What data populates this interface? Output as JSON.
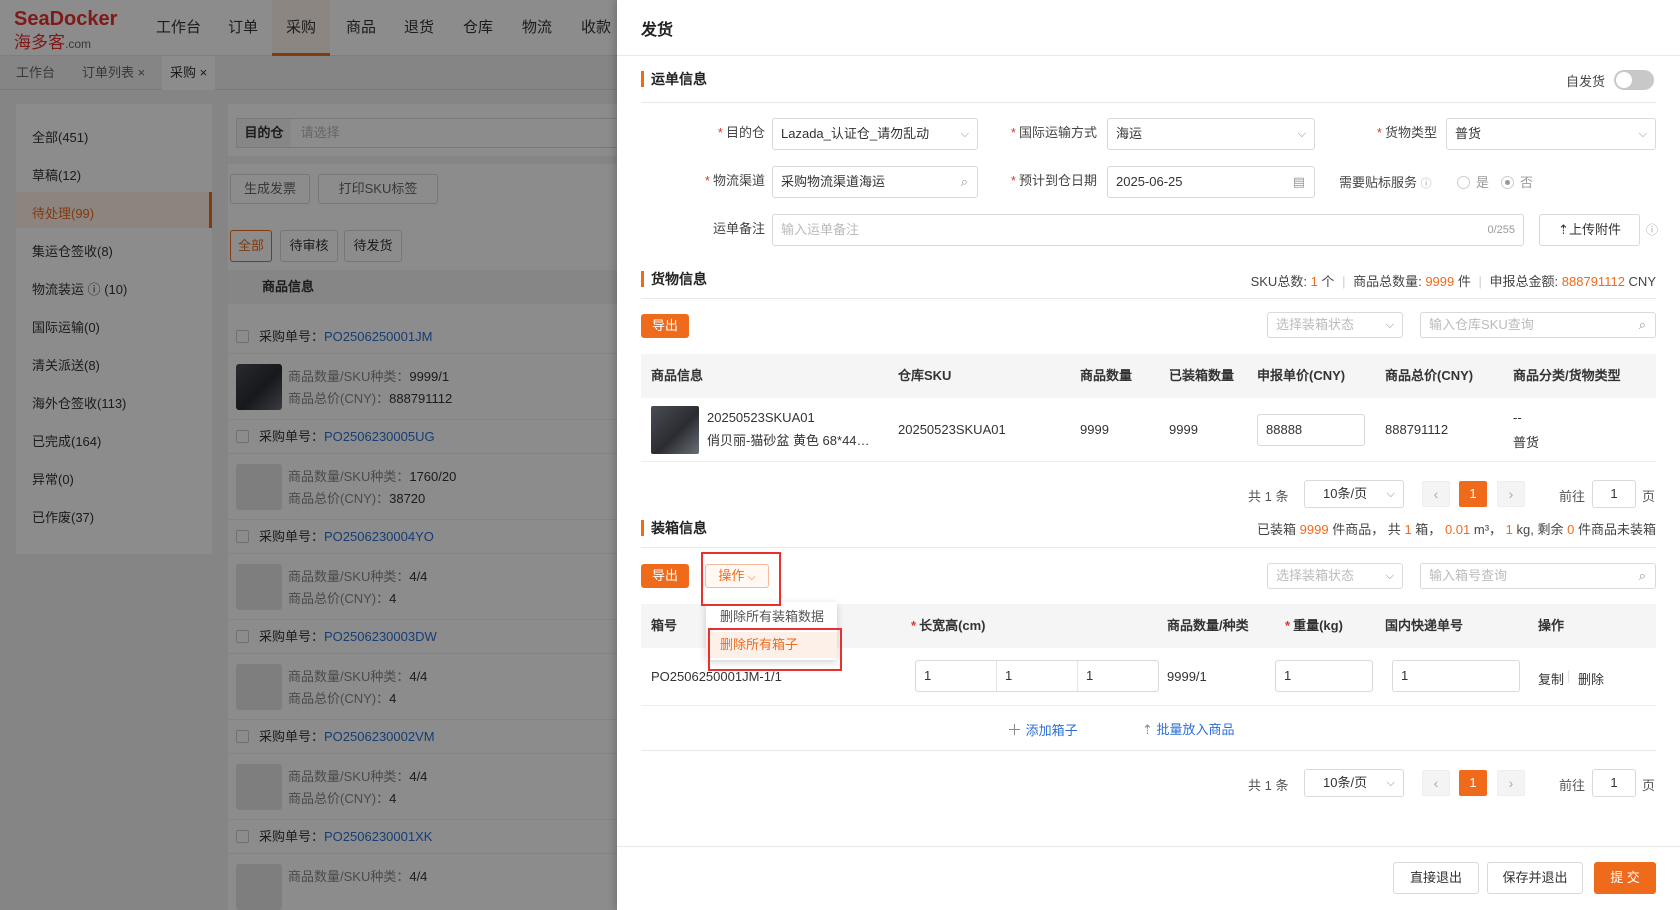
{
  "logo": {
    "brand": "SeaDocker",
    "cn": "海多客",
    "suffix": ".com"
  },
  "topnav": {
    "items": [
      "工作台",
      "订单",
      "采购",
      "商品",
      "退货",
      "仓库",
      "物流",
      "收款"
    ]
  },
  "pagetabs": {
    "items": [
      "工作台",
      "订单列表",
      "采购"
    ]
  },
  "sidebar": {
    "items": [
      "全部(451)",
      "草稿(12)",
      "待处理(99)",
      "集运仓签收(8)",
      "物流装运 ⓘ (10)",
      "国际运输(0)",
      "清关派送(8)",
      "海外仓签收(113)",
      "已完成(164)",
      "异常(0)",
      "已作废(37)"
    ]
  },
  "main": {
    "dest_label": "目的仓",
    "dest_placeholder": "请选择",
    "btn_invoice": "生成发票",
    "btn_print": "打印SKU标签",
    "tabs": [
      "全部",
      "待审核",
      "待发货"
    ],
    "col_product": "商品信息",
    "orders": [
      {
        "label": "采购单号：",
        "no": "PO2506250001JM",
        "qty_label": "商品数量/SKU种类：",
        "qty": "9999/1",
        "price_label": "商品总价(CNY)：",
        "price": "888791112"
      },
      {
        "label": "采购单号：",
        "no": "PO2506230005UG",
        "qty_label": "商品数量/SKU种类：",
        "qty": "1760/20",
        "price_label": "商品总价(CNY)：",
        "price": "38720"
      },
      {
        "label": "采购单号：",
        "no": "PO2506230004YO",
        "qty_label": "商品数量/SKU种类：",
        "qty": "4/4",
        "price_label": "商品总价(CNY)：",
        "price": "4"
      },
      {
        "label": "采购单号：",
        "no": "PO2506230003DW",
        "qty_label": "商品数量/SKU种类：",
        "qty": "4/4",
        "price_label": "商品总价(CNY)：",
        "price": "4"
      },
      {
        "label": "采购单号：",
        "no": "PO2506230002VM",
        "qty_label": "商品数量/SKU种类：",
        "qty": "4/4",
        "price_label": "商品总价(CNY)：",
        "price": "4"
      },
      {
        "label": "采购单号：",
        "no": "PO2506230001XK",
        "qty_label": "商品数量/SKU种类：",
        "qty": "4/4",
        "price_label": "",
        "price": ""
      }
    ]
  },
  "drawer": {
    "title": "发货",
    "waybill": {
      "section": "运单信息",
      "self_ship_label": "自发货",
      "dest_label": "目的仓",
      "dest_value": "Lazada_认证仓_请勿乱动",
      "transport_label": "国际运输方式",
      "transport_value": "海运",
      "cargo_label": "货物类型",
      "cargo_value": "普货",
      "channel_label": "物流渠道",
      "channel_value": "采购物流渠道海运",
      "eta_label": "预计到仓日期",
      "eta_value": "2025-06-25",
      "label_service": "需要贴标服务",
      "opt_yes": "是",
      "opt_no": "否",
      "remark_label": "运单备注",
      "remark_placeholder": "输入运单备注",
      "remark_count": "0/255",
      "upload": "上传附件"
    },
    "goods": {
      "section": "货物信息",
      "summary": {
        "sku_label": "SKU总数:",
        "sku_value": "1",
        "sku_unit": "个",
        "qty_label": "商品总数量:",
        "qty_value": "9999",
        "qty_unit": "件",
        "amount_label": "申报总金额:",
        "amount_value": "888791112",
        "amount_unit": "CNY"
      },
      "export": "导出",
      "status_placeholder": "选择装箱状态",
      "sku_search_placeholder": "输入仓库SKU查询",
      "columns": [
        "商品信息",
        "仓库SKU",
        "商品数量",
        "已装箱数量",
        "申报单价(CNY)",
        "商品总价(CNY)",
        "商品分类/货物类型"
      ],
      "row": {
        "sku_code": "20250523SKUA01",
        "name": "俏贝丽-猫砂盆 黄色 68*44…",
        "warehouse_sku": "20250523SKUA01",
        "qty": "9999",
        "packed": "9999",
        "unit_price": "88888",
        "total": "888791112",
        "category": "--",
        "cargo_type": "普货"
      },
      "pager": {
        "total": "共 1 条",
        "size": "10条/页",
        "page": "1",
        "goto": "前往",
        "goto_value": "1",
        "unit": "页"
      }
    },
    "packing": {
      "section": "装箱信息",
      "summary": {
        "p1": "已装箱",
        "packed": "9999",
        "p2": "件商品，  共",
        "boxes": "1",
        "p3": "箱，",
        "volume": "0.01",
        "p4": "m³，",
        "weight": "1",
        "p5": "kg, 剩余",
        "remaining": "0",
        "p6": "件商品未装箱"
      },
      "export": "导出",
      "op_button": "操作",
      "menu": [
        "删除所有装箱数据",
        "删除所有箱子"
      ],
      "status_placeholder": "选择装箱状态",
      "box_search_placeholder": "输入箱号查询",
      "columns": {
        "box_no": "箱号",
        "dims": "长宽高(cm)",
        "qty_kind": "商品数量/种类",
        "weight": "重量(kg)",
        "tracking": "国内快递单号",
        "ops": "操作"
      },
      "row": {
        "box_no": "PO2506250001JM-1/1",
        "l": "1",
        "w": "1",
        "h": "1",
        "qty_kind": "9999/1",
        "weight": "1",
        "tracking": "1",
        "copy": "复制",
        "delete": "删除"
      },
      "add_box": "添加箱子",
      "batch_add": "批量放入商品",
      "pager": {
        "total": "共 1 条",
        "size": "10条/页",
        "page": "1",
        "goto": "前往",
        "goto_value": "1",
        "unit": "页"
      }
    },
    "footer": {
      "exit": "直接退出",
      "save_exit": "保存并退出",
      "submit": "提 交"
    }
  },
  "colors": {
    "accent": "#f06a1c",
    "danger": "#e8302f",
    "link": "#2b6fd6"
  }
}
